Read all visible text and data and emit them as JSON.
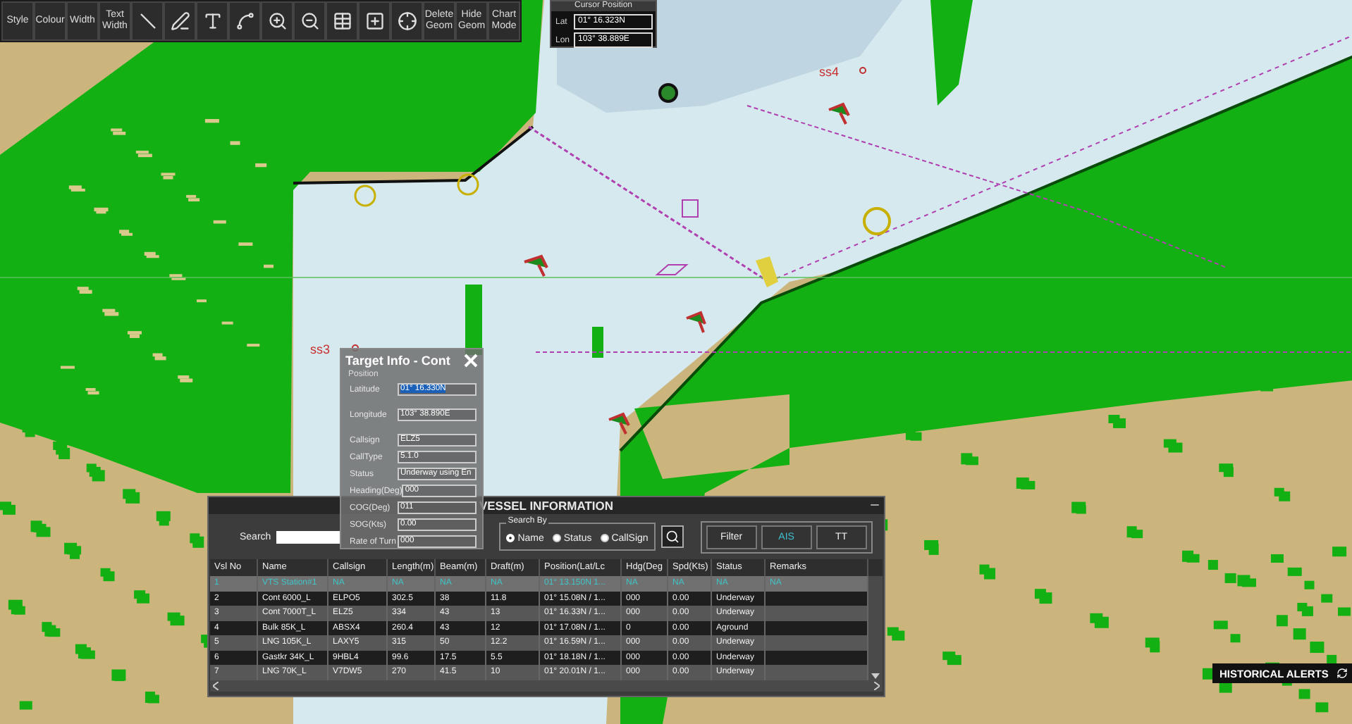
{
  "toolbar": {
    "buttons": [
      {
        "kind": "text",
        "label": "Style"
      },
      {
        "kind": "text",
        "label": "Colour"
      },
      {
        "kind": "text",
        "label": "Width"
      },
      {
        "kind": "text",
        "label": "Text Width"
      },
      {
        "kind": "icon"
      },
      {
        "kind": "icon"
      },
      {
        "kind": "icon"
      },
      {
        "kind": "icon"
      },
      {
        "kind": "icon"
      },
      {
        "kind": "icon"
      },
      {
        "kind": "icon"
      },
      {
        "kind": "icon"
      },
      {
        "kind": "icon"
      },
      {
        "kind": "text",
        "label": "Delete Geom"
      },
      {
        "kind": "text",
        "label": "Hide Geom"
      },
      {
        "kind": "text",
        "label": "Chart Mode"
      }
    ]
  },
  "cursor_position": {
    "title": "Cursor Position",
    "fields": [
      {
        "label": "Lat",
        "value": "01° 16.323N"
      },
      {
        "label": "Lon",
        "value": "103° 38.889E"
      }
    ]
  },
  "map": {
    "labels": [
      "ss3",
      "ss4"
    ]
  },
  "target_info": {
    "title": "Target Info - Cont",
    "group": "Position",
    "position_fields": [
      {
        "label": "Latitude",
        "value": "01° 16.330N",
        "selected": true
      },
      {
        "label": "Longitude",
        "value": "103° 38.890E",
        "selected": false
      }
    ],
    "fields": [
      {
        "label": "Callsign",
        "value": "ELZ5"
      },
      {
        "label": "CallType",
        "value": "5.1.0"
      },
      {
        "label": "Status",
        "value": "Underway using En"
      },
      {
        "label": "Heading(Deg)",
        "value": "000"
      },
      {
        "label": "COG(Deg)",
        "value": "011"
      },
      {
        "label": "SOG(Kts)",
        "value": "0.00"
      },
      {
        "label": "Rate of Turn",
        "value": "000"
      }
    ]
  },
  "vessel_information": {
    "title": "VESSEL INFORMATION",
    "search_label": "Search",
    "search_by": {
      "title": "Search By",
      "options": [
        {
          "label": "Name",
          "selected": true
        },
        {
          "label": "Status",
          "selected": false
        },
        {
          "label": "CallSign",
          "selected": false
        }
      ]
    },
    "sources": [
      {
        "label": "Filter",
        "selected": false
      },
      {
        "label": "AIS",
        "selected": true
      },
      {
        "label": "TT",
        "selected": false
      }
    ],
    "table": {
      "columns": [
        "Vsl No",
        "Name",
        "Callsign",
        "Length(m)",
        "Beam(m)",
        "Draft(m)",
        "Position(Lat/Lc",
        "Hdg(Deg",
        "Spd(Kts)",
        "Status",
        "Remarks"
      ],
      "rows": [
        {
          "selected": true,
          "cells": [
            "1",
            "VTS Station#1",
            "NA",
            "NA",
            "NA",
            "NA",
            "01° 13.150N 1...",
            "NA",
            "NA",
            "NA",
            "NA"
          ]
        },
        {
          "selected": false,
          "cells": [
            "2",
            "Cont 6000_L",
            "ELPO5",
            "302.5",
            "38",
            "11.8",
            "01° 15.08N / 1...",
            "000",
            "0.00",
            "Underway"
          ]
        },
        {
          "selected": false,
          "cells": [
            "3",
            "Cont 7000T_L",
            "ELZ5",
            "334",
            "43",
            "13",
            "01° 16.33N / 1...",
            "000",
            "0.00",
            "Underway"
          ]
        },
        {
          "selected": false,
          "cells": [
            "4",
            "Bulk 85K_L",
            "ABSX4",
            "260.4",
            "43",
            "12",
            "01° 17.08N / 1...",
            "0",
            "0.00",
            "Aground"
          ]
        },
        {
          "selected": false,
          "cells": [
            "5",
            "LNG 105K_L",
            "LAXY5",
            "315",
            "50",
            "12.2",
            "01° 16.59N / 1...",
            "000",
            "0.00",
            "Underway"
          ]
        },
        {
          "selected": false,
          "cells": [
            "6",
            "Gastkr 34K_L",
            "9HBL4",
            "99.6",
            "17.5",
            "5.5",
            "01° 18.18N / 1...",
            "000",
            "0.00",
            "Underway"
          ]
        },
        {
          "selected": false,
          "cells": [
            "7",
            "LNG 70K_L",
            "V7DW5",
            "270",
            "41.5",
            "10",
            "01° 20.01N / 1...",
            "000",
            "0.00",
            "Underway"
          ]
        }
      ]
    }
  },
  "historical_alerts": {
    "label": "HISTORICAL ALERTS"
  }
}
